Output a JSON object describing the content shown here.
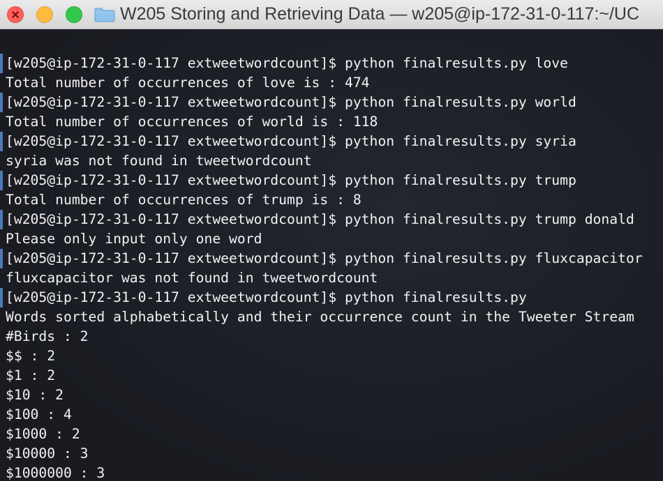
{
  "window": {
    "title": "W205 Storing and Retrieving Data — w205@ip-172-31-0-117:~/UC",
    "folder_icon": "folder-icon"
  },
  "terminal": {
    "lines": [
      {
        "text": "[w205@ip-172-31-0-117 extweetwordcount]$ python finalresults.py love",
        "kind": "command"
      },
      {
        "text": "Total number of occurrences of love is : 474",
        "kind": "output"
      },
      {
        "text": "[w205@ip-172-31-0-117 extweetwordcount]$ python finalresults.py world",
        "kind": "command"
      },
      {
        "text": "Total number of occurrences of world is : 118",
        "kind": "output"
      },
      {
        "text": "[w205@ip-172-31-0-117 extweetwordcount]$ python finalresults.py syria",
        "kind": "command"
      },
      {
        "text": "syria was not found in tweetwordcount",
        "kind": "output"
      },
      {
        "text": "[w205@ip-172-31-0-117 extweetwordcount]$ python finalresults.py trump",
        "kind": "command"
      },
      {
        "text": "Total number of occurrences of trump is : 8",
        "kind": "output"
      },
      {
        "text": "[w205@ip-172-31-0-117 extweetwordcount]$ python finalresults.py trump donald",
        "kind": "command"
      },
      {
        "text": "Please only input only one word",
        "kind": "output"
      },
      {
        "text": "[w205@ip-172-31-0-117 extweetwordcount]$ python finalresults.py fluxcapacitor",
        "kind": "command"
      },
      {
        "text": "fluxcapacitor was not found in tweetwordcount",
        "kind": "output"
      },
      {
        "text": "[w205@ip-172-31-0-117 extweetwordcount]$ python finalresults.py",
        "kind": "command"
      },
      {
        "text": "Words sorted alphabetically and their occurrence count in the Tweeter Stream",
        "kind": "output"
      },
      {
        "text": "#Birds : 2",
        "kind": "output"
      },
      {
        "text": "$$ : 2",
        "kind": "output"
      },
      {
        "text": "$1 : 2",
        "kind": "output"
      },
      {
        "text": "$10 : 2",
        "kind": "output"
      },
      {
        "text": "$100 : 4",
        "kind": "output"
      },
      {
        "text": "$1000 : 2",
        "kind": "output"
      },
      {
        "text": "$10000 : 3",
        "kind": "output"
      },
      {
        "text": "$1000000 : 3",
        "kind": "output"
      }
    ]
  },
  "colors": {
    "text": "#f2f2f2",
    "background": "#1c1f26",
    "prompt_marker": "#4f79b8"
  }
}
